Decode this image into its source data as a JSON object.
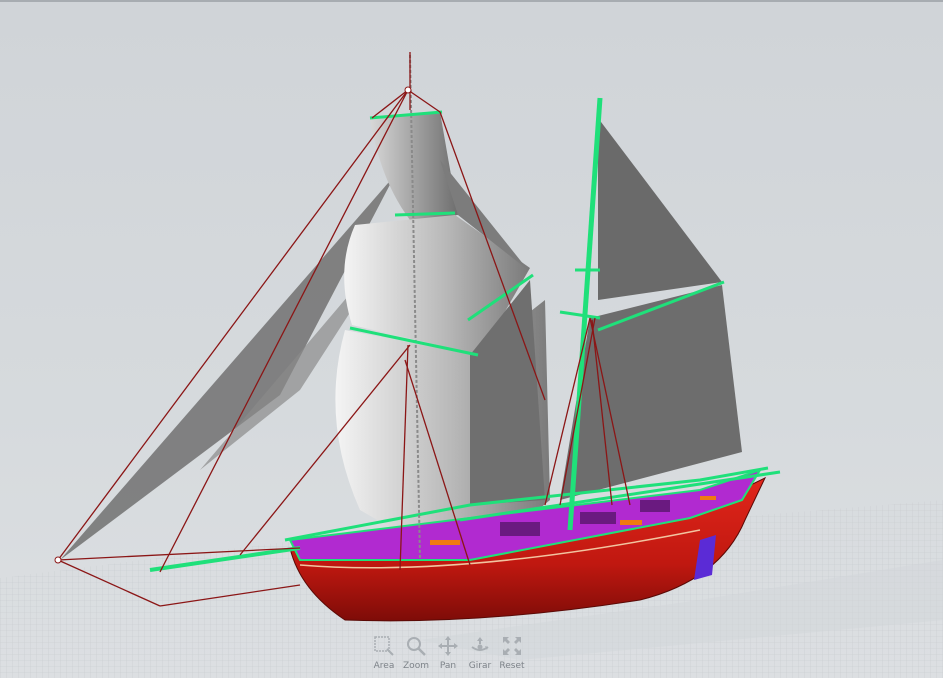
{
  "viewer": {
    "background": "#d4d8dc",
    "grid_color": "#c6cacd",
    "hull_color": "#cc1a10",
    "deck_color": "#b12ad0",
    "highlight_color": "#1fe07a",
    "rigging_color": "#8b1616"
  },
  "toolbar": {
    "tools": [
      {
        "label": "Area",
        "icon": "area-zoom-icon"
      },
      {
        "label": "Zoom",
        "icon": "zoom-icon"
      },
      {
        "label": "Pan",
        "icon": "pan-icon"
      },
      {
        "label": "Girar",
        "icon": "rotate-icon"
      },
      {
        "label": "Reset",
        "icon": "reset-view-icon"
      }
    ]
  }
}
